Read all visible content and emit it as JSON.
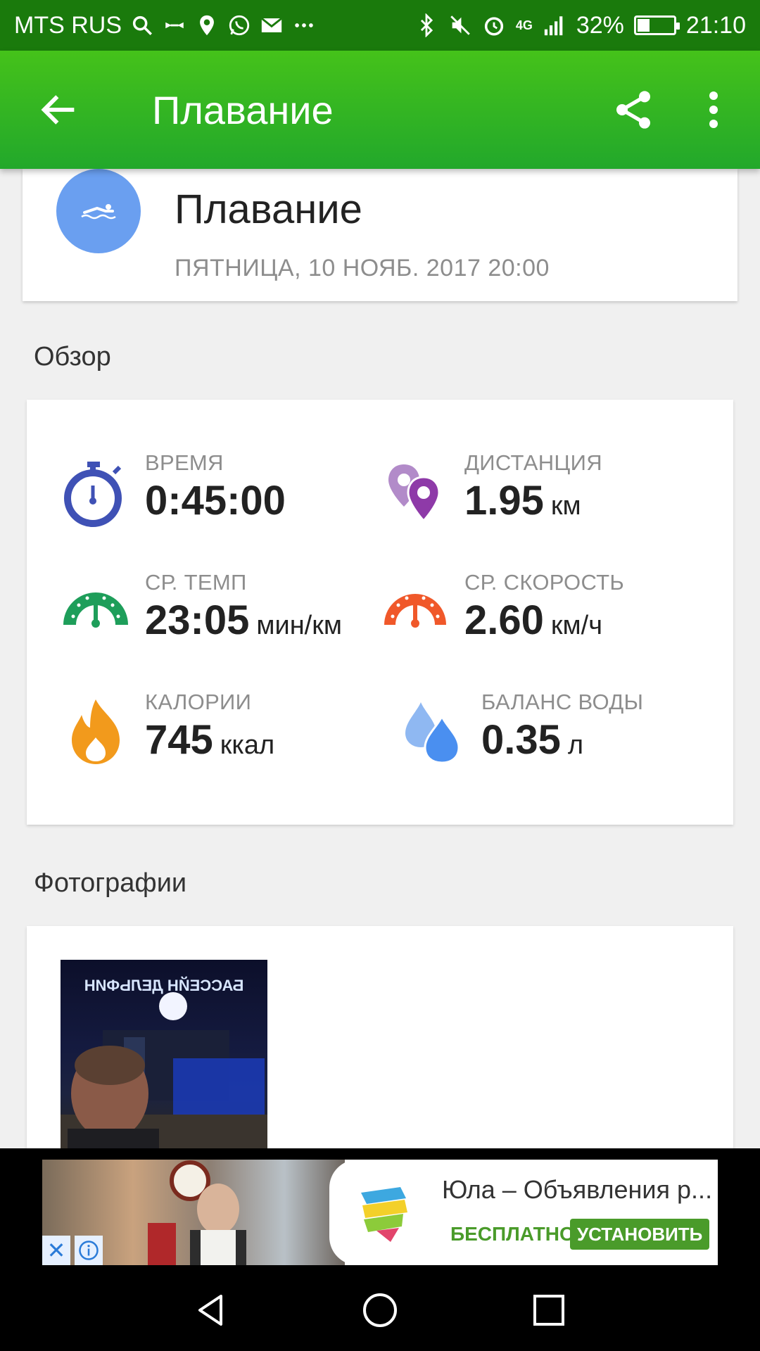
{
  "status_bar": {
    "carrier": "MTS RUS",
    "network": "4G",
    "battery_percent": "32%",
    "battery_level": 0.32,
    "time": "21:10",
    "icons": [
      "search-icon",
      "controller-icon",
      "location-icon",
      "whatsapp-icon",
      "mail-icon",
      "more-dots-icon",
      "bluetooth-icon",
      "mute-icon",
      "alarm-icon",
      "signal-icon",
      "battery-icon"
    ]
  },
  "app_bar": {
    "title": "Плавание",
    "icons": [
      "back-arrow-icon",
      "share-icon",
      "more-vert-icon"
    ]
  },
  "activity": {
    "title": "Плавание",
    "date": "ПЯТНИЦА, 10 НОЯБ. 2017 20:00",
    "icon": "swimmer-icon",
    "color": "#6a9ff0"
  },
  "overview": {
    "section_title": "Обзор",
    "stats": [
      {
        "label": "ВРЕМЯ",
        "value": "0:45:00",
        "unit": "",
        "icon": "stopwatch-icon",
        "color": "#3f51b5"
      },
      {
        "label": "ДИСТАНЦИЯ",
        "value": "1.95",
        "unit": "км",
        "icon": "location-pins-icon",
        "color": "#8e3aa8"
      },
      {
        "label": "СР. ТЕМП",
        "value": "23:05",
        "unit": "мин/км",
        "icon": "pace-gauge-icon",
        "color": "#1e9e5a"
      },
      {
        "label": "СР. СКОРОСТЬ",
        "value": "2.60",
        "unit": "км/ч",
        "icon": "speed-gauge-icon",
        "color": "#f0582a"
      },
      {
        "label": "КАЛОРИИ",
        "value": "745",
        "unit": "ккал",
        "icon": "flame-icon",
        "color": "#f29a1c"
      },
      {
        "label": "БАЛАНС ВОДЫ",
        "value": "0.35",
        "unit": "л",
        "icon": "water-drops-icon",
        "color": "#4a8ff0"
      }
    ]
  },
  "photos": {
    "section_title": "Фотографии",
    "sign_text": "БАССЕЙН ДЕЛЬФИН"
  },
  "ad": {
    "title": "Юла – Объявления р...",
    "price": "БЕСПЛАТНО",
    "install_label": "УСТАНОВИТЬ",
    "close_glyph": "✕"
  },
  "nav": {
    "icons": [
      "back-triangle-icon",
      "home-circle-icon",
      "recents-square-icon"
    ]
  }
}
